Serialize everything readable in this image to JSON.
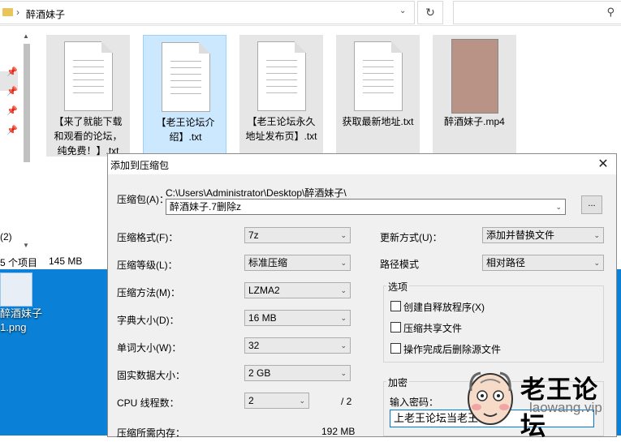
{
  "explorer": {
    "path_separator": "›",
    "path": "醉酒妹子",
    "refresh_icon": "refresh-icon",
    "search_icon": "search-icon",
    "nav_count_label": "(2)",
    "files": [
      {
        "name": "【来了就能下载和观看的论坛，纯免费！】.txt",
        "type": "txt",
        "selected": false
      },
      {
        "name": "【老王论坛介绍】.txt",
        "type": "txt",
        "selected": true
      },
      {
        "name": "【老王论坛永久地址发布页】.txt",
        "type": "txt",
        "selected": false
      },
      {
        "name": "获取最新地址.txt",
        "type": "txt",
        "selected": false
      },
      {
        "name": "醉酒妹子.mp4",
        "type": "mp4",
        "selected": false
      }
    ],
    "file_lines": [
      [
        "【来了就能下载",
        "和观看的论坛，",
        "纯免费！】.txt"
      ],
      [
        "【老王论坛介",
        "绍】.txt"
      ],
      [
        "【老王论坛永久",
        "地址发布页】.txt"
      ],
      [
        "获取最新地址.txt"
      ],
      [
        "醉酒妹子.mp4"
      ]
    ],
    "status_items": "5 个项目",
    "status_size": "145 MB"
  },
  "desktop": {
    "icon_label_line1": "醉酒妹子",
    "icon_label_line2": "1.png"
  },
  "dialog": {
    "title": "添加到压缩包",
    "close_icon": "close-icon",
    "archive_label": "压缩包(A)：",
    "archive_dir": "C:\\Users\\Administrator\\Desktop\\醉酒妹子\\",
    "archive_name": "醉酒妹子.7删除z",
    "browse_label": "...",
    "format_label": "压缩格式(F)：",
    "format_value": "7z",
    "level_label": "压缩等级(L)：",
    "level_value": "标准压缩",
    "method_label": "压缩方法(M)：",
    "method_value": "LZMA2",
    "dict_label": "字典大小(D)：",
    "dict_value": "16 MB",
    "word_label": "单词大小(W)：",
    "word_value": "32",
    "solid_label": "固实数据大小：",
    "solid_value": "2 GB",
    "cpu_label": "CPU 线程数：",
    "cpu_value": "2",
    "cpu_total": "/ 2",
    "memory_label": "压缩所需内存：",
    "memory_value": "192 MB",
    "update_label": "更新方式(U)：",
    "update_value": "添加并替换文件",
    "pathmode_label": "路径模式",
    "pathmode_value": "相对路径",
    "options_title": "选项",
    "opt_sfx": "创建自释放程序(X)",
    "opt_shared": "压缩共享文件",
    "opt_delete": "操作完成后删除源文件",
    "encrypt_title": "加密",
    "password_label": "输入密码：",
    "password_value": "上老王论坛当老王"
  },
  "watermark": {
    "title": "老王论坛",
    "url": "laowang.vip"
  },
  "colors": {
    "desktop_bg": "#0a81d6",
    "selection_bg": "#cce8ff",
    "focus_border": "#0078d7"
  }
}
